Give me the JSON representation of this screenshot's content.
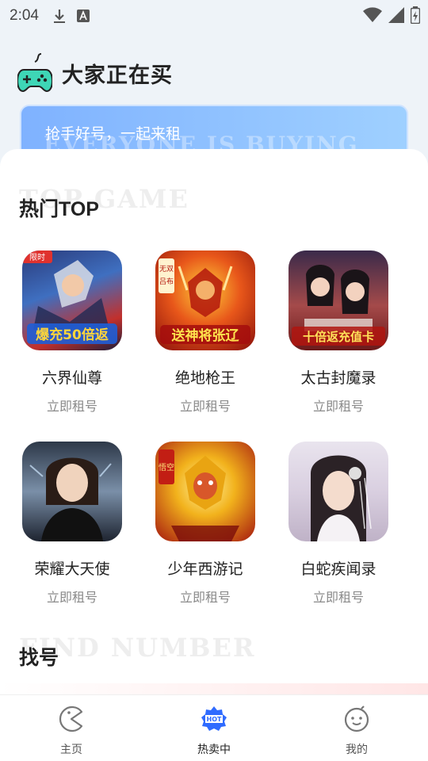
{
  "status_bar": {
    "time": "2:04",
    "icons": [
      "download-icon",
      "a-notification-icon",
      "wifi-icon",
      "signal-icon",
      "battery-icon"
    ]
  },
  "header": {
    "title": "大家正在买",
    "logo_icon": "gamepad-icon"
  },
  "banner": {
    "text": "抢手好号，一起来租",
    "watermark": "EVERYONE IS BUYING"
  },
  "hot_section": {
    "title": "热门TOP",
    "watermark": "TOP GAME",
    "games": [
      {
        "name": "六界仙尊",
        "action": "立即租号",
        "art_badge": "限时",
        "art_text": "爆充50倍返"
      },
      {
        "name": "绝地枪王",
        "action": "立即租号",
        "art_badge": "无双吕布",
        "art_text": "送神将张辽"
      },
      {
        "name": "太古封魔录",
        "action": "立即租号",
        "art_text": "十倍返充值卡"
      },
      {
        "name": "荣耀大天使",
        "action": "立即租号"
      },
      {
        "name": "少年西游记",
        "action": "立即租号",
        "art_badge": "悟空"
      },
      {
        "name": "白蛇疾闻录",
        "action": "立即租号"
      }
    ]
  },
  "find_section": {
    "title": "找号",
    "watermark": "FIND NUMBER"
  },
  "bottom_nav": {
    "items": [
      {
        "label": "主页",
        "icon": "pacman-home-icon",
        "active": false
      },
      {
        "label": "热卖中",
        "icon": "hot-badge-icon",
        "active": true
      },
      {
        "label": "我的",
        "icon": "smiley-face-icon",
        "active": false
      }
    ]
  },
  "colors": {
    "accent_blue": "#2f6bff",
    "banner_start": "#7fb2ff",
    "banner_end": "#9fd0ff",
    "logo_green": "#3ed6b6"
  }
}
